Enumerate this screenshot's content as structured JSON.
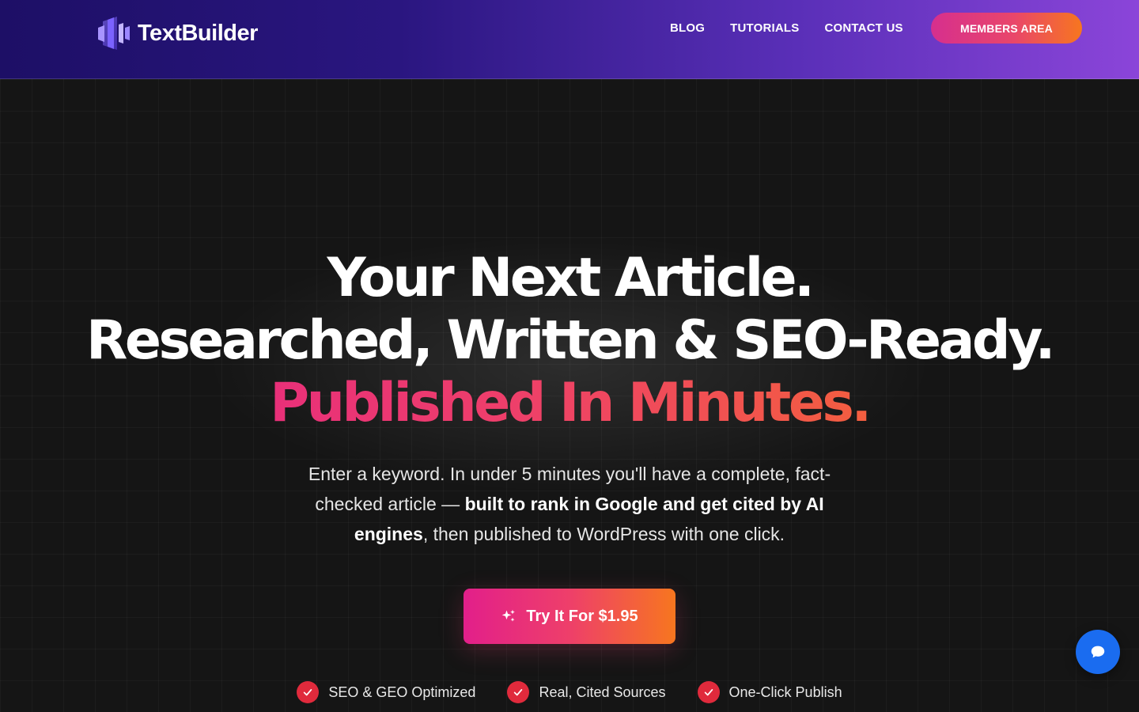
{
  "brand": {
    "name": "TextBuilder",
    "logo_icon": "textbuilder-logo-icon",
    "accent_gradient": [
      "#e21f8a",
      "#f7761f"
    ],
    "header_gradient": [
      "#1d0f66",
      "#8b45d9"
    ]
  },
  "nav": {
    "items": [
      {
        "label": "BLOG"
      },
      {
        "label": "TUTORIALS"
      },
      {
        "label": "CONTACT US"
      }
    ],
    "members_label": "MEMBERS AREA"
  },
  "hero": {
    "line1": "Your Next Article.",
    "line2": "Researched, Written & SEO-Ready.",
    "line3": "Published In Minutes.",
    "sub_part1": "Enter a keyword. In under 5 minutes you'll have a complete, fact-checked article — ",
    "sub_bold": "built to rank in Google and get cited by AI engines",
    "sub_part2": ", then published to WordPress with one click.",
    "cta_label": "Try It For $1.95",
    "cta_icon": "sparkles-icon"
  },
  "features": [
    {
      "label": "SEO & GEO Optimized",
      "icon": "check-icon"
    },
    {
      "label": "Real, Cited Sources",
      "icon": "check-icon"
    },
    {
      "label": "One-Click Publish",
      "icon": "check-icon"
    }
  ],
  "chat": {
    "icon": "chat-bubble-icon",
    "color": "#1a6cf0"
  }
}
